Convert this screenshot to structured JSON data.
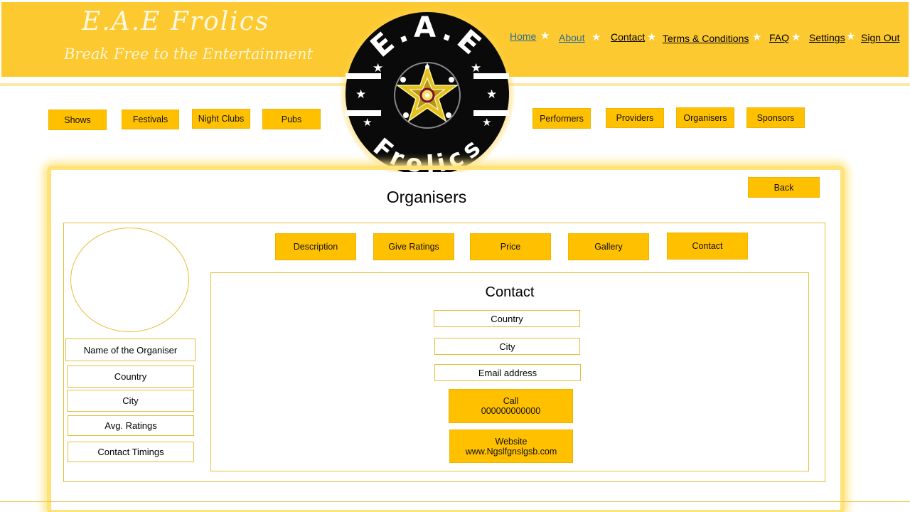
{
  "header": {
    "brand_title": "E.A.E Frolics",
    "brand_subtitle": "Break Free to the Entertainment",
    "logo": {
      "top_text": "E.A.E",
      "bottom_text": "Frolics"
    },
    "nav": [
      {
        "label": "Home",
        "state": "visited"
      },
      {
        "label": "About",
        "state": "visited"
      },
      {
        "label": "Contact",
        "state": "normal"
      },
      {
        "label": "Terms & Conditions",
        "state": "normal"
      },
      {
        "label": "FAQ",
        "state": "normal"
      },
      {
        "label": "Settings",
        "state": "normal"
      },
      {
        "label": "Sign Out",
        "state": "normal"
      }
    ],
    "separator_icon": "star-icon"
  },
  "categories": {
    "left": [
      "Shows",
      "Festivals",
      "Night Clubs",
      "Pubs"
    ],
    "right": [
      "Performers",
      "Providers",
      "Organisers",
      "Sponsors"
    ]
  },
  "page": {
    "title": "Organisers",
    "back_label": "Back"
  },
  "profile": {
    "name": "Name of the Organiser",
    "country": "Country",
    "city": "City",
    "ratings": "Avg. Ratings",
    "timings": "Contact Timings"
  },
  "tabs": [
    "Description",
    "Give Ratings",
    "Price",
    "Gallery",
    "Contact"
  ],
  "contact": {
    "title": "Contact",
    "country": "Country",
    "city": "City",
    "email": "Email address",
    "call_label": "Call",
    "call_number": "000000000000",
    "website_label": "Website",
    "website_url": "www.Ngslfgnslgsb.com"
  },
  "colors": {
    "accent": "#ffc000",
    "header": "#fdc930",
    "border": "#e6be3a",
    "link_visited": "#2c6e93"
  }
}
